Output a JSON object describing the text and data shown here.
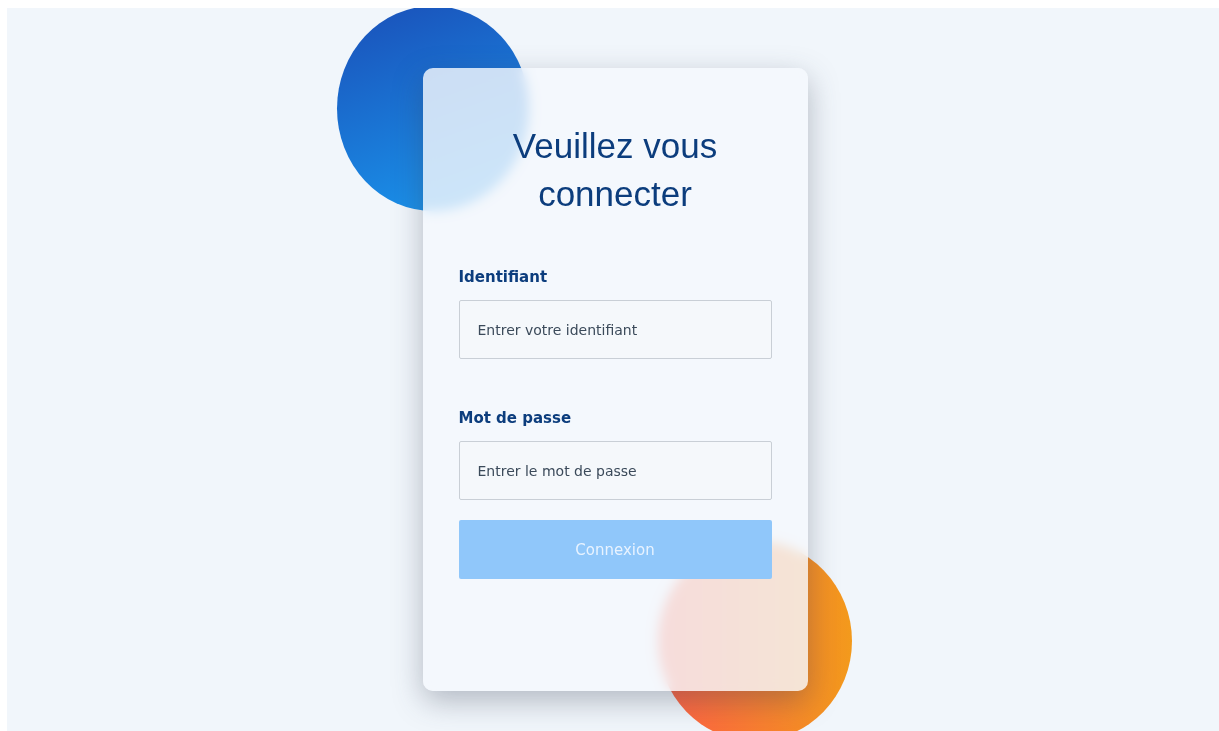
{
  "title": "Veuillez vous connecter",
  "fields": [
    {
      "label": "Identifiant",
      "placeholder": "Entrer votre identifiant"
    },
    {
      "label": "Mot de passe",
      "placeholder": "Entrer le mot de passe"
    }
  ],
  "button": {
    "label": "Connexion",
    "disabled": true
  }
}
